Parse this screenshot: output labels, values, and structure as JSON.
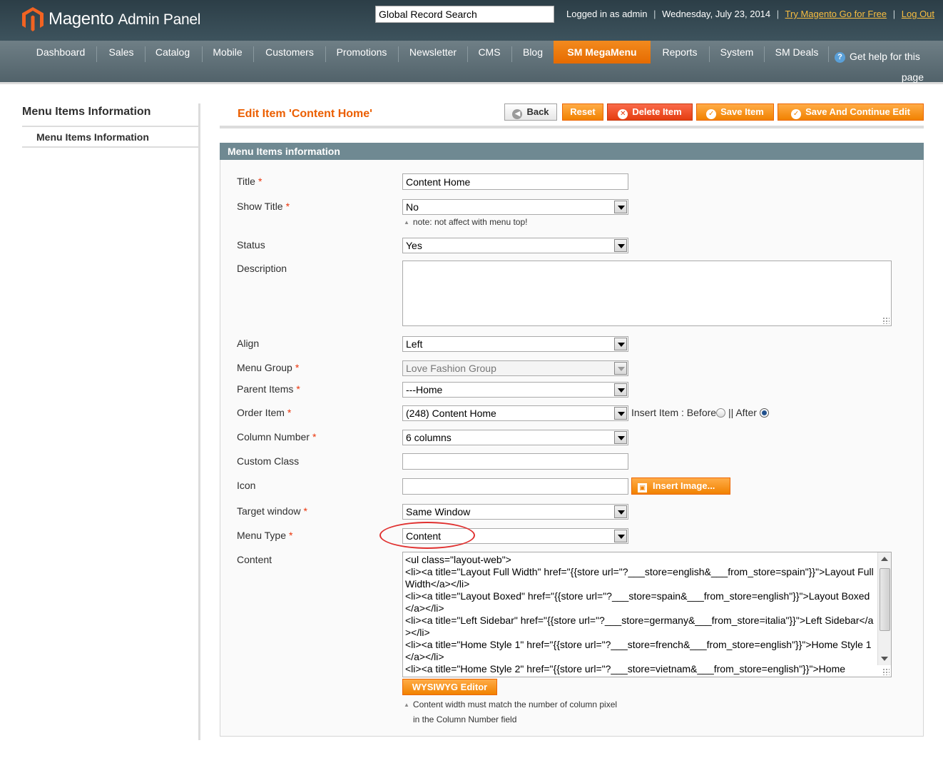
{
  "header": {
    "brand": "Magento",
    "brand_sub": "Admin Panel",
    "search_value": "Global Record Search",
    "logged_in": "Logged in as admin",
    "date": "Wednesday, July 23, 2014",
    "try_link": "Try Magento Go for Free",
    "logout": "Log Out",
    "separator": "|"
  },
  "nav": {
    "items": [
      {
        "label": "Dashboard"
      },
      {
        "label": "Sales"
      },
      {
        "label": "Catalog"
      },
      {
        "label": "Mobile"
      },
      {
        "label": "Customers"
      },
      {
        "label": "Promotions"
      },
      {
        "label": "Newsletter"
      },
      {
        "label": "CMS"
      },
      {
        "label": "Blog"
      },
      {
        "label": "SM MegaMenu"
      },
      {
        "label": "Reports"
      },
      {
        "label": "System"
      },
      {
        "label": "SM Deals"
      }
    ],
    "active": "SM MegaMenu",
    "help_line1": "Get help for this",
    "help_line2": "page"
  },
  "sidebar": {
    "title": "Menu Items Information",
    "item": "Menu Items Information"
  },
  "page": {
    "title": "Edit Item 'Content Home'",
    "buttons": {
      "back": "Back",
      "reset": "Reset",
      "delete": "Delete Item",
      "save": "Save Item",
      "save_continue": "Save And Continue Edit"
    },
    "section_title": "Menu Items information"
  },
  "form": {
    "title": {
      "label": "Title",
      "value": "Content Home"
    },
    "show_title": {
      "label": "Show Title",
      "value": "No",
      "note": "note: not affect with menu top!"
    },
    "status": {
      "label": "Status",
      "value": "Yes"
    },
    "description": {
      "label": "Description",
      "value": ""
    },
    "align": {
      "label": "Align",
      "value": "Left"
    },
    "menu_group": {
      "label": "Menu Group",
      "value": "Love Fashion Group"
    },
    "parent_items": {
      "label": "Parent Items",
      "value": "---Home"
    },
    "order_item": {
      "label": "Order Item",
      "value": "(248) Content Home",
      "insert_label": "Insert Item : Before",
      "after_label": "|| After",
      "selected": "after"
    },
    "column_number": {
      "label": "Column Number",
      "value": "6 columns"
    },
    "custom_class": {
      "label": "Custom Class",
      "value": ""
    },
    "icon": {
      "label": "Icon",
      "value": "",
      "button": "Insert Image..."
    },
    "target_window": {
      "label": "Target window",
      "value": "Same Window"
    },
    "menu_type": {
      "label": "Menu Type",
      "value": "Content"
    },
    "content": {
      "label": "Content",
      "value": "<ul class=\"layout-web\">\n<li><a title=\"Layout Full Width\" href=\"{{store url=\"?___store=english&___from_store=spain\"}}\">Layout Full Width</a></li>\n<li><a title=\"Layout Boxed\" href=\"{{store url=\"?___store=spain&___from_store=english\"}}\">Layout Boxed</a></li>\n<li><a title=\"Left Sidebar\" href=\"{{store url=\"?___store=germany&___from_store=italia\"}}\">Left Sidebar</a></li>\n<li><a title=\"Home Style 1\" href=\"{{store url=\"?___store=french&___from_store=english\"}}\">Home Style 1</a></li>\n<li><a title=\"Home Style 2\" href=\"{{store url=\"?___store=vietnam&___from_store=english\"}}\">Home",
      "button": "WYSIWYG Editor",
      "note_line1": "Content width must match the number of column pixel",
      "note_line2": "in the Column Number field"
    },
    "required_mark": "*"
  },
  "colors": {
    "accent": "#eb5e00",
    "header_bg": "#2c3e47",
    "nav_bg": "#5f6f77",
    "section_bg": "#6f8992",
    "highlight": "#e0302f"
  }
}
